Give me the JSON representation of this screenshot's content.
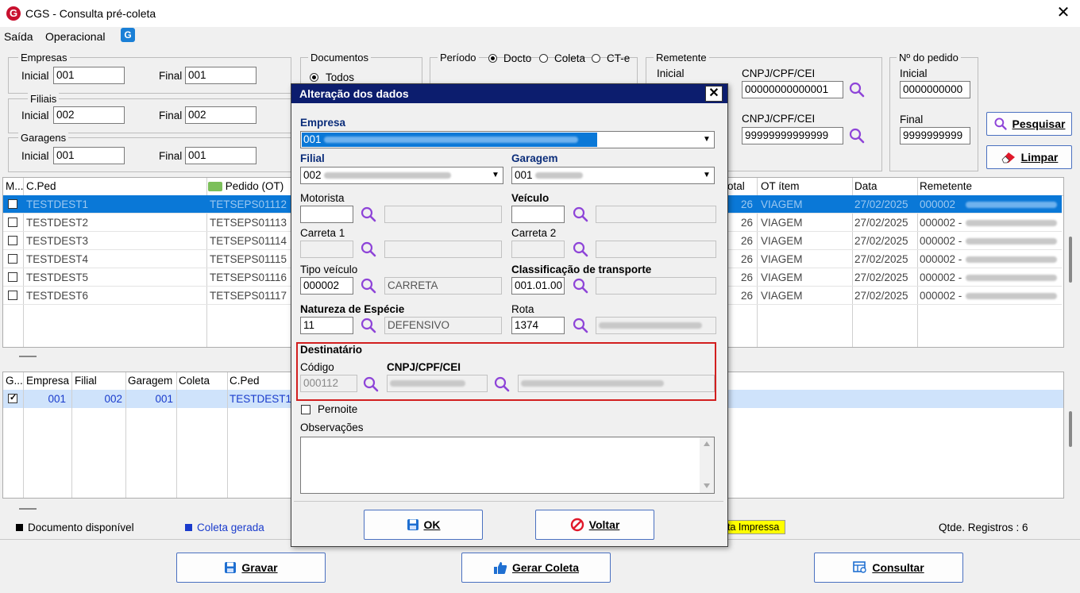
{
  "window": {
    "title": "CGS - Consulta pré-coleta",
    "app_icon": "G"
  },
  "menu": {
    "items": [
      "Saída",
      "Operacional"
    ]
  },
  "filters": {
    "empresas": {
      "legend": "Empresas",
      "inicial_label": "Inicial",
      "inicial": "001",
      "final_label": "Final",
      "final": "001"
    },
    "filiais": {
      "legend": "Filiais",
      "inicial_label": "Inicial",
      "inicial": "002",
      "final_label": "Final",
      "final": "002"
    },
    "garagens": {
      "legend": "Garagens",
      "inicial_label": "Inicial",
      "inicial": "001",
      "final_label": "Final",
      "final": "001"
    },
    "documentos": {
      "legend": "Documentos",
      "option_todos": "Todos"
    },
    "periodo": {
      "legend": "Período",
      "options": [
        "Docto",
        "Coleta",
        "CT-e"
      ]
    },
    "remetente": {
      "legend": "Remetente",
      "inicial_label": "Inicial",
      "cnpj_label_1": "CNPJ/CPF/CEI",
      "cnpj_1": "00000000000001",
      "cnpj_label_2": "CNPJ/CPF/CEI",
      "cnpj_2": "99999999999999"
    },
    "pedido": {
      "legend": "Nº do pedido",
      "inicial_label": "Inicial",
      "inicial": "0000000000",
      "final_label": "Final",
      "final": "9999999999"
    }
  },
  "buttons": {
    "pesquisar": "Pesquisar",
    "limpar": "Limpar",
    "gravar": "Gravar",
    "gerar_coleta": "Gerar Coleta",
    "consultar": "Consultar"
  },
  "grid_top": {
    "headers": {
      "m": "M...",
      "cped": "C.Ped",
      "pedido": "Pedido (OT)",
      "total": "otal",
      "ot_item": "OT ítem",
      "data": "Data",
      "remetente": "Remetente"
    },
    "rows": [
      {
        "cped": "TESTDEST1",
        "pedido": "TETSEPS01112",
        "total": "26",
        "ot_item": "VIAGEM",
        "data": "27/02/2025",
        "remetente": "000002"
      },
      {
        "cped": "TESTDEST2",
        "pedido": "TETSEPS01113",
        "total": "26",
        "ot_item": "VIAGEM",
        "data": "27/02/2025",
        "remetente": "000002 -"
      },
      {
        "cped": "TESTDEST3",
        "pedido": "TETSEPS01114",
        "total": "26",
        "ot_item": "VIAGEM",
        "data": "27/02/2025",
        "remetente": "000002 -"
      },
      {
        "cped": "TESTDEST4",
        "pedido": "TETSEPS01115",
        "total": "26",
        "ot_item": "VIAGEM",
        "data": "27/02/2025",
        "remetente": "000002 -"
      },
      {
        "cped": "TESTDEST5",
        "pedido": "TETSEPS01116",
        "total": "26",
        "ot_item": "VIAGEM",
        "data": "27/02/2025",
        "remetente": "000002 -"
      },
      {
        "cped": "TESTDEST6",
        "pedido": "TETSEPS01117",
        "total": "26",
        "ot_item": "VIAGEM",
        "data": "27/02/2025",
        "remetente": "000002 -"
      }
    ]
  },
  "grid_bottom": {
    "headers": {
      "g": "G...",
      "empresa": "Empresa",
      "filial": "Filial",
      "garagem": "Garagem",
      "coleta": "Coleta",
      "cped": "C.Ped"
    },
    "rows": [
      {
        "empresa": "001",
        "filial": "002",
        "garagem": "001",
        "coleta": "",
        "cped": "TESTDEST1"
      }
    ]
  },
  "legend_bar": {
    "documento_disponivel": "Documento disponível",
    "coleta_gerada": "Coleta gerada",
    "impressa": "ta Impressa",
    "qtde": "Qtde. Registros : 6"
  },
  "colors": {
    "dialog_title_bg": "#0c1d6e",
    "selection": "#0a78d7",
    "highlight_border": "#d21f1f",
    "bottom_row": "#cfe3fb",
    "impressa_bg": "#ffff00"
  },
  "dialog": {
    "title": "Alteração dos dados",
    "empresa_label": "Empresa",
    "empresa_value": "001",
    "filial_label": "Filial",
    "filial_value": "002",
    "garagem_label": "Garagem",
    "garagem_value": "001",
    "motorista_label": "Motorista",
    "veiculo_label": "Veículo",
    "carreta1_label": "Carreta 1",
    "carreta2_label": "Carreta 2",
    "tipo_veiculo_label": "Tipo veículo",
    "tipo_veiculo_code": "000002",
    "tipo_veiculo_desc": "CARRETA",
    "classificacao_label": "Classificação de transporte",
    "classificacao_code": "001.01.00",
    "natureza_label": "Natureza de Espécie",
    "natureza_code": "11",
    "natureza_desc": "DEFENSIVO",
    "rota_label": "Rota",
    "rota_code": "1374",
    "destinatario_label": "Destinatário",
    "codigo_label": "Código",
    "codigo_value": "000112",
    "cnpj_label": "CNPJ/CPF/CEI",
    "pernoite_label": "Pernoite",
    "observacoes_label": "Observações",
    "ok": "OK",
    "voltar": "Voltar"
  }
}
